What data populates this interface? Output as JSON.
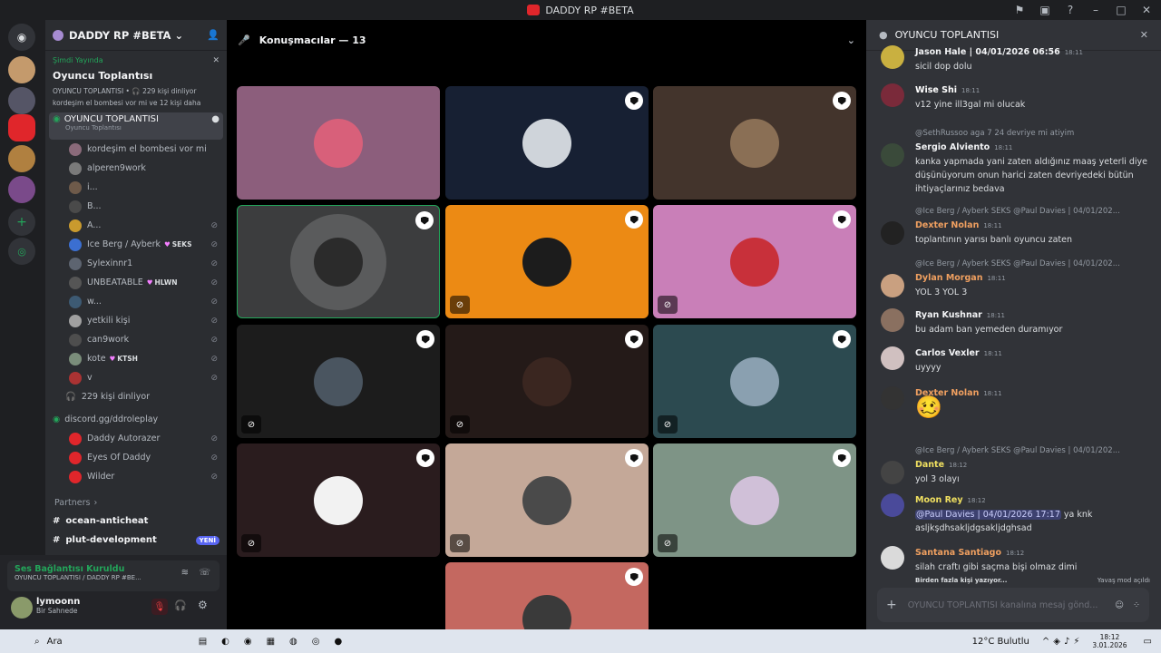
{
  "window": {
    "title": "DADDY RP #BETA"
  },
  "server": {
    "name": "DADDY RP #BETA"
  },
  "stage": {
    "live_label": "Şimdi Yayında",
    "title": "Oyuncu Toplantısı",
    "info": "OYUNCU TOPLANTISI • 🎧 229 kişi dinliyor",
    "speakers_preview": "kordeşim el bombesi vor mi ve 12 kişi daha"
  },
  "active_channel": {
    "name": "OYUNCU TOPLANTISI",
    "topic": "Oyuncu Toplantısı"
  },
  "members": [
    {
      "name": "kordeşim el bombesi vor mi",
      "tag": "",
      "color": "#8a6a7a"
    },
    {
      "name": "alperen9work",
      "tag": "",
      "color": "#7a7a7a"
    },
    {
      "name": "i...",
      "tag": "",
      "color": "#6e5a4a"
    },
    {
      "name": "B...",
      "tag": "",
      "color": "#4a4a4a"
    },
    {
      "name": "A...",
      "tag": "",
      "color": "#c99a2e"
    },
    {
      "name": "Ice Berg / Ayberk",
      "tag": "SEKS",
      "color": "#3b6fd1"
    },
    {
      "name": "Sylexinnr1",
      "tag": "",
      "color": "#5d6470"
    },
    {
      "name": "UNBEATABLE",
      "tag": "HLWN",
      "color": "#555"
    },
    {
      "name": "w...",
      "tag": "",
      "color": "#3d5a73"
    },
    {
      "name": "yetkili kişi",
      "tag": "",
      "color": "#a0a0a0"
    },
    {
      "name": "can9work",
      "tag": "",
      "color": "#4e4e4e"
    },
    {
      "name": "kote",
      "tag": "KTSH",
      "color": "#7a8d7a"
    },
    {
      "name": "v",
      "tag": "",
      "color": "#aa3333"
    }
  ],
  "listeners": "229 kişi dinliyor",
  "other_channel": "discord.gg/ddroleplay",
  "bots": [
    "Daddy Autorazer",
    "Eyes Of Daddy",
    "Wilder"
  ],
  "categories": {
    "partners": "Partners",
    "ch1": "ocean-anticheat",
    "ch2": "plut-development",
    "new_badge": "YENİ"
  },
  "voice": {
    "status": "Ses Bağlantısı Kuruldu",
    "location": "OYUNCU TOPLANTISI / DADDY RP #BE..."
  },
  "user": {
    "name": "lymoonn",
    "status": "Bir Sahnede"
  },
  "speakers_header": "Konuşmacılar — 13",
  "tiles": [
    {
      "bg": "#8c5e7c",
      "pfp": "#d8607a"
    },
    {
      "bg": "#172033",
      "pfp": "#cfd4da"
    },
    {
      "bg": "#43342c",
      "pfp": "#8a6f55"
    },
    {
      "bg": "#3c3d3e",
      "pfp": "#2b2b2b"
    },
    {
      "bg": "#ec8a14",
      "pfp": "#1c1c1c"
    },
    {
      "bg": "#c97fb8",
      "pfp": "#c8303a"
    },
    {
      "bg": "#1c1c1c",
      "pfp": "#4a5560"
    },
    {
      "bg": "#241a18",
      "pfp": "#3a2620"
    },
    {
      "bg": "#2c4a50",
      "pfp": "#8aa0b0"
    },
    {
      "bg": "#2a1c1e",
      "pfp": "#f2f2f2"
    },
    {
      "bg": "#c4a898",
      "pfp": "#4a4a4a"
    },
    {
      "bg": "#7e9486",
      "pfp": "#d0c0d8"
    },
    {
      "bg": "#c46860",
      "pfp": "#3a3a3a"
    }
  ],
  "chat": {
    "channel": "OYUNCU TOPLANTISI",
    "messages": [
      {
        "name": "Jason Hale | 04/01/2026 06:56",
        "time": "18:11",
        "text": "sicil dop dolu",
        "reply": ""
      },
      {
        "name": "Wise Shi",
        "time": "18:11",
        "text": "v12 yine ill3gal mi olucak",
        "reply": ""
      },
      {
        "name": "Sergio Alviento",
        "time": "18:11",
        "text": "kanka yapmada yani zaten aldığınız maaş yeterli diye düşünüyorum onun harici zaten devriyedeki bütün ihtiyaçlarınız bedava",
        "reply": "@SethRussoo aga 7 24 devriye mi atiyim"
      },
      {
        "name": "Dexter Nolan",
        "time": "18:11",
        "text": "toplantının yarısı banlı oyuncu zaten",
        "reply": "@Ice Berg / Ayberk SEKS @Paul Davies | 04/01/202..."
      },
      {
        "name": "Dylan Morgan",
        "time": "18:11",
        "text": "YOL 3 YOL 3",
        "reply": "@Ice Berg / Ayberk SEKS @Paul Davies | 04/01/202..."
      },
      {
        "name": "Ryan Kushnar",
        "time": "18:11",
        "text": "bu adam ban yemeden duramıyor",
        "reply": ""
      },
      {
        "name": "Carlos Vexler",
        "time": "18:11",
        "text": "uyyyy",
        "reply": ""
      },
      {
        "name": "Dexter Nolan",
        "time": "18:11",
        "text": "",
        "reply": ""
      },
      {
        "name": "Dante",
        "time": "18:12",
        "text": "yol 3 olayı",
        "reply": "@Ice Berg / Ayberk SEKS @Paul Davies | 04/01/202..."
      },
      {
        "name": "Moon Rey",
        "time": "18:12",
        "text": "asljkşdhsakljdgsakljdghsad",
        "mention": "@Paul Davies | 04/01/2026 17:17",
        "after": " ya knk",
        "reply": ""
      },
      {
        "name": "Santana Santiago",
        "time": "18:12",
        "text": "silah craftı gibi saçma bişi olmaz dimi",
        "reply": ""
      }
    ],
    "typing": "Birden fazla kişi yazıyor...",
    "slowmode": "Yavaş mod açıldı",
    "input_placeholder": "OYUNCU TOPLANTISI kanalına mesaj gönd..."
  },
  "taskbar": {
    "search": "Ara",
    "weather": "12°C  Bulutlu",
    "time": "18:12",
    "date": "3.01.2026"
  }
}
